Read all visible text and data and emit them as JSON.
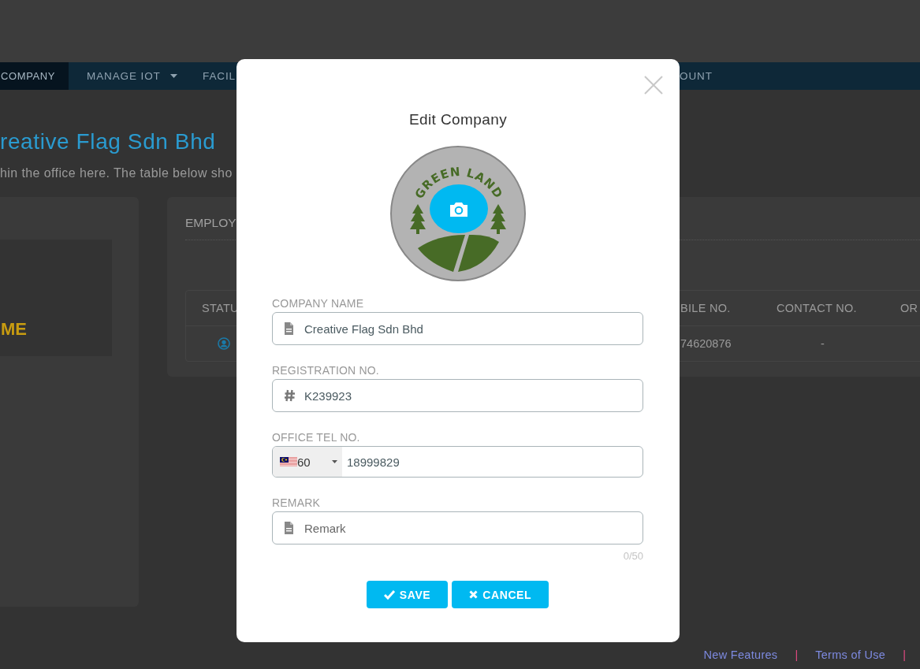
{
  "nav": {
    "items": [
      {
        "label": "COMPANY",
        "selected": true,
        "has_caret": false
      },
      {
        "label": "MANAGE IOT",
        "selected": false,
        "has_caret": true
      },
      {
        "label": "FACIL",
        "selected": false,
        "has_caret": false
      },
      {
        "label": "OUNT",
        "selected": false,
        "has_caret": false
      }
    ]
  },
  "page": {
    "title": "reative Flag Sdn Bhd",
    "subtitle": "hin the office here. The table below sho"
  },
  "profile_card": {
    "image_text": "ME"
  },
  "employee_card": {
    "title": "EMPLOY",
    "columns": [
      "STATU",
      "BILE NO.",
      "CONTACT NO.",
      "OR"
    ],
    "rows": [
      {
        "mobile_no": "74620876",
        "contact_no": "-"
      }
    ]
  },
  "footer": {
    "items": [
      {
        "kind": "link",
        "text": "New Features"
      },
      {
        "kind": "separator",
        "text": "|"
      },
      {
        "kind": "link",
        "text": "Terms of Use"
      },
      {
        "kind": "separator",
        "text": "|"
      }
    ]
  },
  "dialog": {
    "title": "Edit Company",
    "logo": {
      "text": "GREEN LAND"
    },
    "fields": [
      {
        "kind": "text",
        "label": "COMPANY NAME",
        "value": "Creative Flag Sdn Bhd"
      },
      {
        "kind": "code",
        "label": "REGISTRATION NO.",
        "value": "K239923"
      },
      {
        "kind": "phone",
        "label": "OFFICE TEL NO.",
        "country_code": "60",
        "value": "18999829"
      },
      {
        "kind": "text",
        "label": "REMARK",
        "placeholder": "Remark",
        "counter": "0/50"
      }
    ],
    "buttons": [
      {
        "kind": "save",
        "label": "SAVE"
      },
      {
        "kind": "cancel",
        "label": "CANCEL"
      }
    ]
  }
}
